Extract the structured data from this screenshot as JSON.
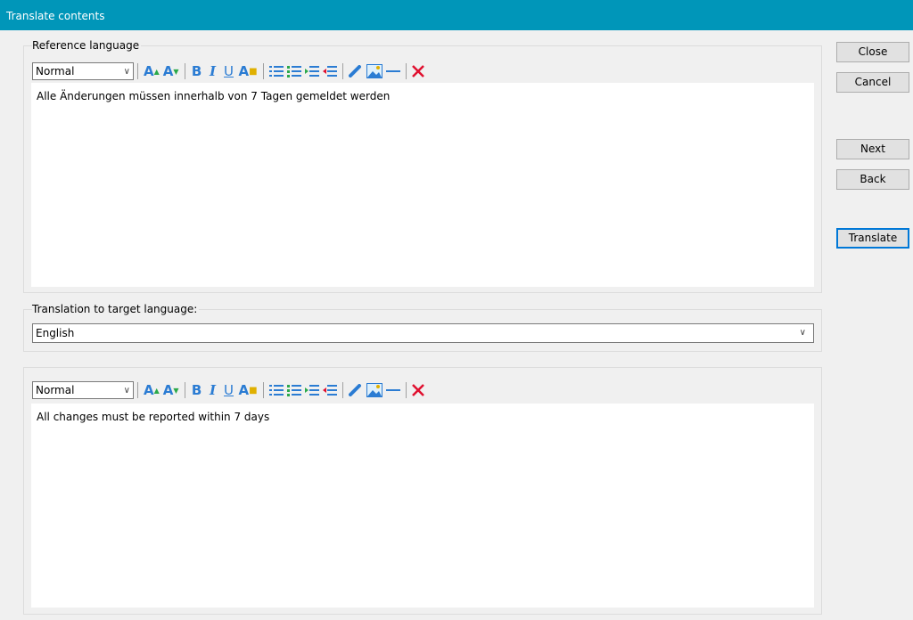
{
  "window": {
    "title": "Translate contents"
  },
  "reference": {
    "group_label": "Reference language",
    "style_value": "Normal",
    "text": "Alle Änderungen müssen innerhalb von 7 Tagen gemeldet werden"
  },
  "target": {
    "group_label": "Translation to target language:",
    "language_value": "English",
    "style_value": "Normal",
    "text": "All changes must be reported within 7 days"
  },
  "buttons": {
    "close": "Close",
    "cancel": "Cancel",
    "next": "Next",
    "back": "Back",
    "translate": "Translate"
  },
  "toolbar_icons": [
    "grow-font-icon",
    "shrink-font-icon",
    "bold-icon",
    "italic-icon",
    "underline-icon",
    "font-color-icon",
    "numbered-list-icon",
    "bulleted-list-icon",
    "indent-icon",
    "outdent-icon",
    "link-icon",
    "image-icon",
    "horizontal-line-icon",
    "clear-format-icon"
  ],
  "colors": {
    "titlebar": "#0096b9",
    "accent": "#2b7cd3",
    "delete": "#e0102f"
  }
}
